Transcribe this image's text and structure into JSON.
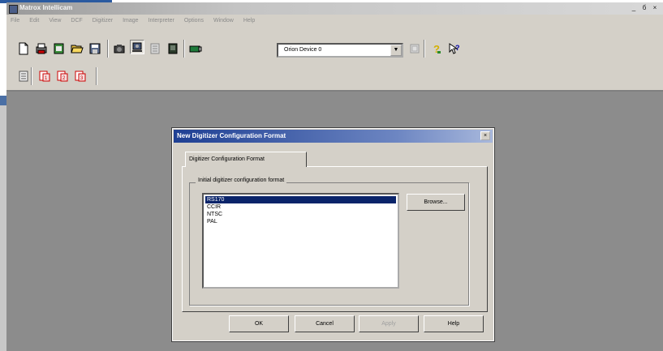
{
  "app": {
    "title": "Matrox Intellicam",
    "window_controls": [
      "_",
      "б",
      "×"
    ],
    "menu": [
      "File",
      "Edit",
      "View",
      "DCF",
      "Digitizer",
      "Image",
      "Interpreter",
      "Options",
      "Window",
      "Help"
    ]
  },
  "toolbar": {
    "device_select": "Orion Device 0"
  },
  "dialog": {
    "title": "New Digitizer Configuration Format",
    "close": "×",
    "tab_label": "Digitizer Configuration Format",
    "group_label": "Initial digitizer configuration format",
    "formats": [
      "RS170",
      "CCIR",
      "NTSC",
      "PAL"
    ],
    "selected_format": "RS170",
    "browse_label": "Browse...",
    "ok_label": "OK",
    "cancel_label": "Cancel",
    "apply_label": "Apply",
    "help_label": "Help"
  }
}
